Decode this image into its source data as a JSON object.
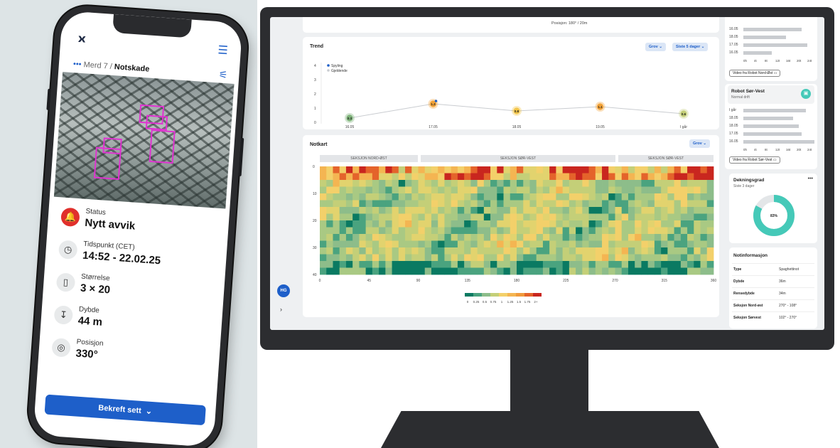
{
  "phone": {
    "breadcrumb_parent": "Merd 7",
    "breadcrumb_sep": "/",
    "breadcrumb_current": "Notskade",
    "rows": [
      {
        "label": "Status",
        "value": "Nytt avvik",
        "icon": "bell-icon"
      },
      {
        "label": "Tidspunkt (CET)",
        "value": "14:52  - 22.02.25",
        "icon": "clock-icon"
      },
      {
        "label": "Størrelse",
        "value": "3 × 20",
        "icon": "size-icon"
      },
      {
        "label": "Dybde",
        "value": "44 m",
        "icon": "depth-icon"
      },
      {
        "label": "Posisjon",
        "value": "330°",
        "icon": "position-icon"
      }
    ],
    "confirm_label": "Bekreft sett",
    "accent": "#1e5fc9",
    "alert_color": "#e0302c"
  },
  "dashboard": {
    "top_position": "Posisjon: 180° / 20m",
    "trend": {
      "title": "Trend",
      "grade_pill": "Grov",
      "period_pill": "Siste 5 dager",
      "legend": [
        "Spyling",
        "Gjeldende"
      ],
      "y_ticks": [
        "4",
        "3",
        "2",
        "1",
        "0"
      ]
    },
    "notkart": {
      "title": "Notkart",
      "grade_pill": "Grov",
      "sections": [
        "SEKSJON NORD-ØST",
        "SEKSJON SØR-VEST",
        "SEKSJON SØR-VEST"
      ],
      "y_ticks": [
        "0",
        "10",
        "20",
        "30",
        "40"
      ],
      "x_ticks": [
        "0",
        "45",
        "90",
        "135",
        "180",
        "225",
        "270",
        "315",
        "360"
      ],
      "scale_ticks": [
        "0",
        "0.25",
        "0.5",
        "0.75",
        "1",
        "1.25",
        "1.5",
        "1.75",
        "2+"
      ],
      "scale_colors": [
        "#0a7a62",
        "#4aa37f",
        "#8dbd8a",
        "#c4cf78",
        "#f3d06a",
        "#f4b552",
        "#f09a3c",
        "#e4632b",
        "#c9261f"
      ]
    },
    "robot_ne": {
      "row_labels": [
        "16.05",
        "18.05",
        "17.05",
        "16.05"
      ],
      "axis": [
        "0h",
        "4t",
        "8t",
        "12t",
        "16t",
        "20t",
        "24t"
      ],
      "video_label": "Video fra Robot Nord-Øst"
    },
    "robot_sw": {
      "name": "Robot Sør-Vest",
      "status": "Normal drift",
      "row_labels": [
        "I går",
        "18.05",
        "18.05",
        "17.05",
        "16.05"
      ],
      "axis": [
        "0h",
        "4t",
        "8t",
        "12t",
        "16t",
        "20t",
        "24t"
      ],
      "video_label": "Video fra Robot Sør-Vest"
    },
    "coverage": {
      "title": "Dekningsgrad",
      "subtitle": "Siste 3 dager",
      "menu": "•••",
      "value_label": "83%",
      "percent": 83,
      "fill_color": "#45c9b8"
    },
    "notinfo": {
      "title": "Notinformasjon",
      "rows": [
        {
          "k": "Type",
          "v": "Spaghettinot"
        },
        {
          "k": "Dybde",
          "v": "36m"
        },
        {
          "k": "Rensedybde",
          "v": "34m"
        },
        {
          "k": "Seksjon Nord-øst",
          "v": "270° - 108°"
        },
        {
          "k": "Seksjon Sørvest",
          "v": "102° - 270°"
        }
      ]
    },
    "avatar_initials": "HG"
  },
  "chart_data": [
    {
      "type": "line",
      "x": [
        "16.05",
        "17.05",
        "18.05",
        "19.05",
        "I går"
      ],
      "values": [
        0.3,
        1.3,
        0.8,
        1.1,
        0.6
      ],
      "value_labels": [
        "0.3",
        "1.3",
        "0.8",
        "1.1",
        "0.6"
      ],
      "ylim": [
        0,
        4
      ],
      "colors": [
        "#7fb37a",
        "#f3a338",
        "#f3c64a",
        "#f3a338",
        "#c4cf78"
      ]
    },
    {
      "type": "heatmap",
      "xlim": [
        0,
        360
      ],
      "ylim": [
        0,
        40
      ],
      "cols": 60,
      "rows": 16
    }
  ]
}
